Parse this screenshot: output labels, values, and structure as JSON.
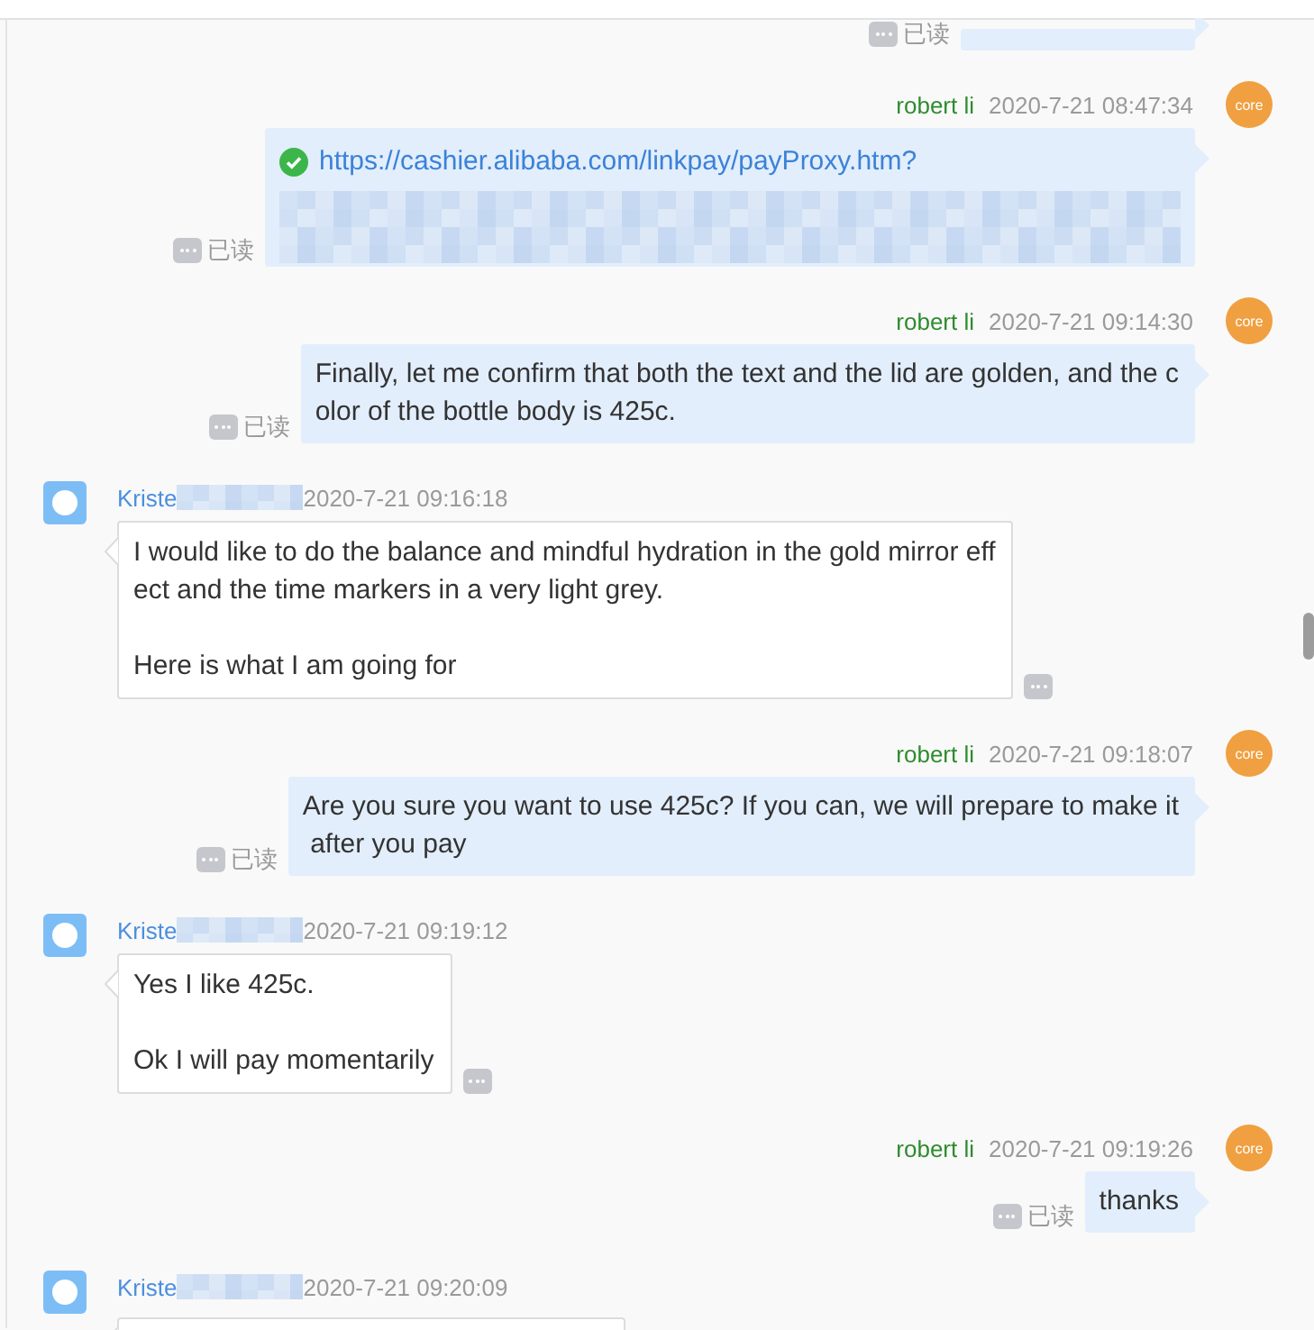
{
  "messages": [
    {
      "kind": "out_cut",
      "read_label": "已读"
    },
    {
      "kind": "out",
      "sender": "robert li",
      "time": "2020-7-21 08:47:34",
      "avatar_text": "core",
      "link": "https://cashier.alibaba.com/linkpay/payProxy.htm?",
      "redacted": true,
      "read_label": "已读"
    },
    {
      "kind": "out",
      "sender": "robert li",
      "time": "2020-7-21 09:14:30",
      "avatar_text": "core",
      "text": "Finally, let me confirm that both the text and the lid are golden, and the c\nolor of the bottle body is 425c.",
      "read_label": "已读"
    },
    {
      "kind": "in",
      "sender": "Kriste",
      "sender_redacted": true,
      "time": "2020-7-21 09:16:18",
      "text": "I would like to do the balance and mindful hydration in the gold mirror eff\nect and the time markers in a very light grey.\n\nHere is what I am going for"
    },
    {
      "kind": "out",
      "sender": "robert li",
      "time": "2020-7-21 09:18:07",
      "avatar_text": "core",
      "text": "Are you sure you want to use 425c? If you can, we will prepare to make it\n after you pay",
      "read_label": "已读"
    },
    {
      "kind": "in",
      "sender": "Kriste",
      "sender_redacted": true,
      "time": "2020-7-21 09:19:12",
      "text": "Yes I like 425c.\n\nOk I will pay momentarily"
    },
    {
      "kind": "out",
      "sender": "robert li",
      "time": "2020-7-21 09:19:26",
      "avatar_text": "core",
      "text": "thanks",
      "read_label": "已读"
    },
    {
      "kind": "in_cut",
      "sender": "Kriste",
      "sender_redacted": true,
      "time": "2020-7-21 09:20:09"
    }
  ]
}
